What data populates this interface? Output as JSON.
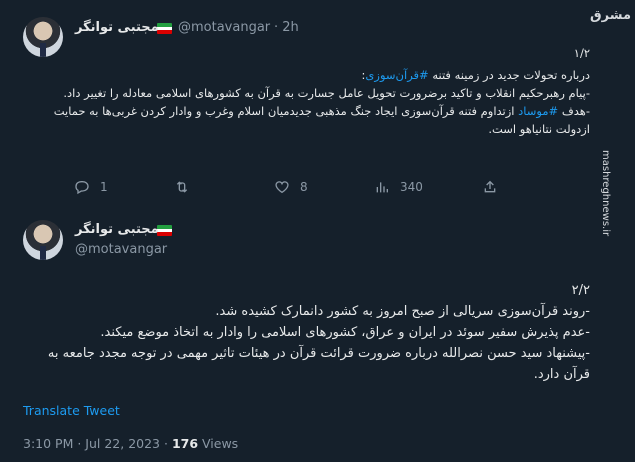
{
  "tweet1": {
    "author_name": "مجتبی توانگر",
    "handle": "@motavangar",
    "time": "· 2h",
    "index": "۱/۲",
    "lines": [
      {
        "pre": "درباره تحولات جدید در زمینه فتنه ",
        "tag": "#قرآن‌سوزی",
        "post": ":"
      },
      {
        "pre": "-پیام رهبرحکیم انقلاب و تاکید برضرورت تحویل عامل جسارت به قرآن به کشورهای اسلامی معادله را تغییر داد.",
        "tag": "",
        "post": ""
      },
      {
        "pre": "-هدف ",
        "tag": "#موساد",
        "post": " ازتداوم فتنه قرآن‌سوزی ایجاد جنگ مذهبی جدیدمیان اسلام وغرب و وادار کردن غربی‌ها به حمایت ازدولت نتانیاهو است."
      }
    ],
    "actions": {
      "replies": "1",
      "retweets": "",
      "likes": "8",
      "views": "340"
    }
  },
  "tweet2": {
    "author_name": "مجتبی توانگر",
    "handle": "@motavangar",
    "index": "۲/۲",
    "lines": [
      "-روند قرآن‌سوزی سریالی از صبح امروز به کشور دانمارک کشیده شد.",
      "-عدم پذیرش سفیر سوئد در ایران و عراق، کشورهای اسلامی را وادار به اتخاذ موضع میکند.",
      "-پیشنهاد سید حسن نصرالله درباره ضرورت قرائت قرآن در هیئات تاثیر مهمی در توجه مجدد جامعه به قرآن دارد."
    ],
    "translate": "Translate Tweet",
    "timestamp": "3:10 PM · Jul 22, 2023 · ",
    "views_count": "176",
    "views_label": " Views"
  },
  "watermark": {
    "logo": "مشرق",
    "site": "mashreghnews.ir"
  },
  "colors": {
    "bg": "#15202b",
    "accent": "#1d9bf0",
    "muted": "#8b98a5",
    "text": "#e7e9ea"
  },
  "icons": [
    "reply-icon",
    "retweet-icon",
    "like-icon",
    "views-icon",
    "share-icon"
  ]
}
